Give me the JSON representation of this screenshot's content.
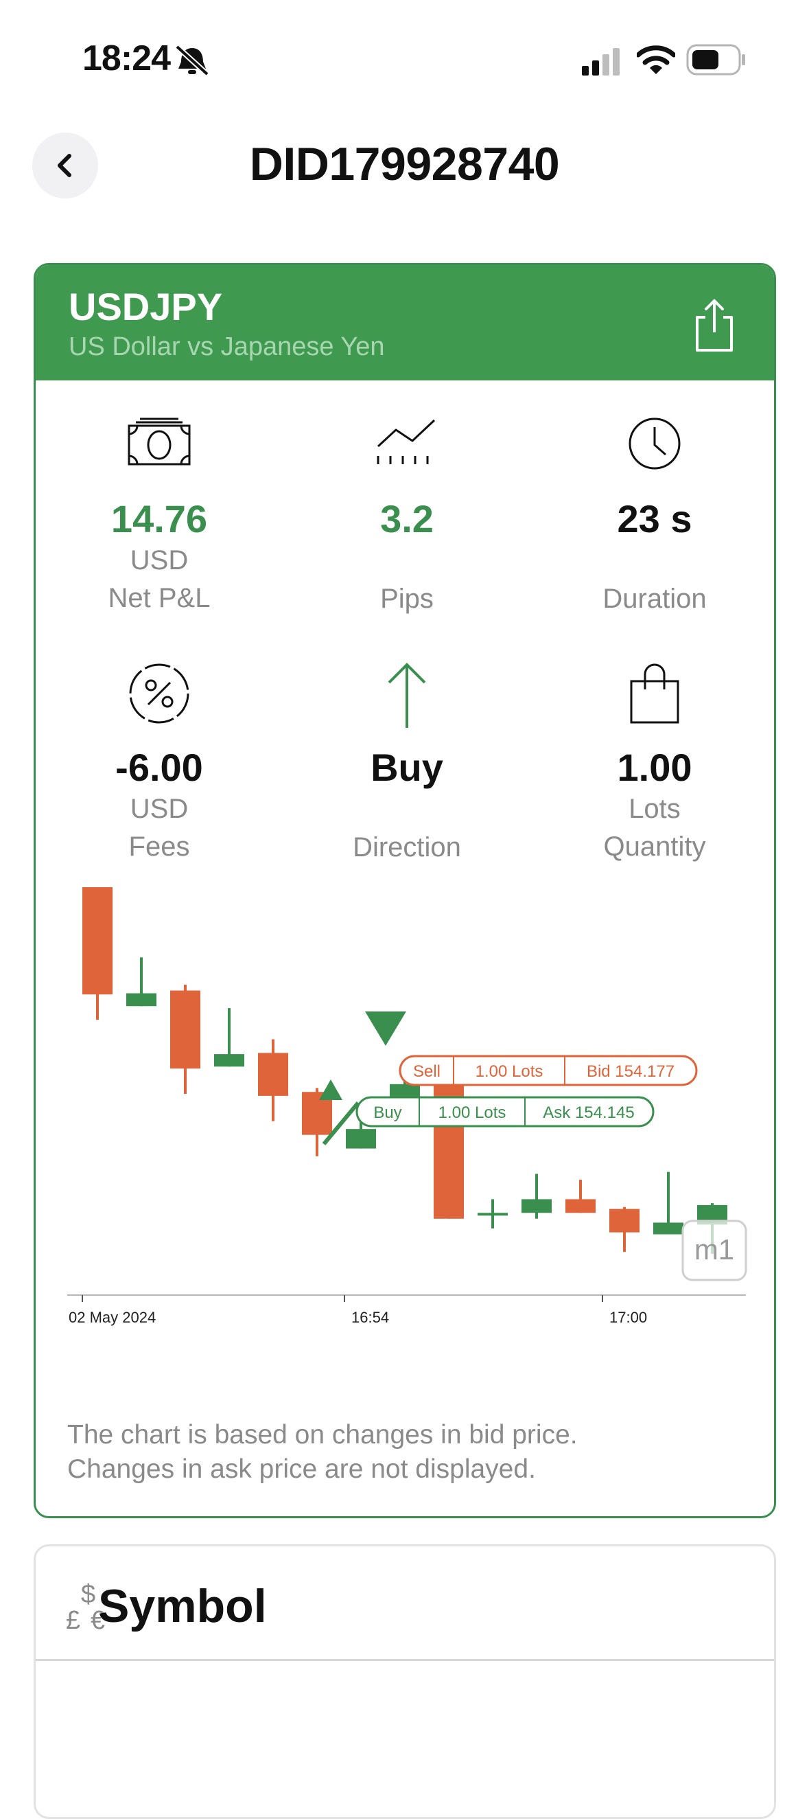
{
  "status_bar": {
    "time": "18:24"
  },
  "nav": {
    "title": "DID179928740"
  },
  "header": {
    "symbol": "USDJPY",
    "description": "US Dollar vs Japanese Yen"
  },
  "stats": {
    "net_pl": {
      "value": "14.76",
      "unit": "USD",
      "label": "Net P&L"
    },
    "pips": {
      "value": "3.2",
      "label": "Pips"
    },
    "duration": {
      "value": "23 s",
      "label": "Duration"
    },
    "fees": {
      "value": "-6.00",
      "unit": "USD",
      "label": "Fees"
    },
    "direction": {
      "value": "Buy",
      "label": "Direction"
    },
    "quantity": {
      "value": "1.00",
      "unit": "Lots",
      "label": "Quantity"
    }
  },
  "chart": {
    "sell_tag": {
      "side": "Sell",
      "lots": "1.00 Lots",
      "price": "Bid 154.177"
    },
    "buy_tag": {
      "side": "Buy",
      "lots": "1.00 Lots",
      "price": "Ask 154.145"
    },
    "timeframe": "m1",
    "x_ticks": [
      "02 May 2024",
      "16:54",
      "17:00"
    ],
    "note_line1": "The chart is based on changes in bid price.",
    "note_line2": "Changes in ask price are not displayed.",
    "colors": {
      "up": "#3a8f4e",
      "down": "#e0643a"
    }
  },
  "chart_data": {
    "type": "candlestick",
    "x_ticks": [
      "02 May 2024",
      "16:54",
      "17:00"
    ],
    "candles": [
      {
        "direction": "down",
        "open": 1.0,
        "close": 0.725,
        "high": 1.0,
        "low": 0.66
      },
      {
        "direction": "up",
        "open": 0.695,
        "close": 0.728,
        "high": 0.82,
        "low": 0.695
      },
      {
        "direction": "down",
        "open": 0.735,
        "close": 0.535,
        "high": 0.75,
        "low": 0.47
      },
      {
        "direction": "up",
        "open": 0.54,
        "close": 0.572,
        "high": 0.69,
        "low": 0.54
      },
      {
        "direction": "down",
        "open": 0.575,
        "close": 0.465,
        "high": 0.61,
        "low": 0.4
      },
      {
        "direction": "down",
        "open": 0.475,
        "close": 0.365,
        "high": 0.485,
        "low": 0.31
      },
      {
        "direction": "up",
        "open": 0.33,
        "close": 0.38,
        "high": 0.4,
        "low": 0.33
      },
      {
        "direction": "up",
        "open": 0.43,
        "close": 0.495,
        "high": 0.55,
        "low": 0.43
      },
      {
        "direction": "down",
        "open": 0.495,
        "close": 0.15,
        "high": 0.5,
        "low": 0.15
      },
      {
        "direction": "up",
        "open": 0.16,
        "close": 0.165,
        "high": 0.2,
        "low": 0.125
      },
      {
        "direction": "up",
        "open": 0.165,
        "close": 0.2,
        "high": 0.265,
        "low": 0.15
      },
      {
        "direction": "down",
        "open": 0.2,
        "close": 0.165,
        "high": 0.25,
        "low": 0.165
      },
      {
        "direction": "down",
        "open": 0.175,
        "close": 0.115,
        "high": 0.18,
        "low": 0.065
      },
      {
        "direction": "up",
        "open": 0.11,
        "close": 0.14,
        "high": 0.27,
        "low": 0.11
      },
      {
        "direction": "up",
        "open": 0.135,
        "close": 0.185,
        "high": 0.19,
        "low": 0.06
      }
    ],
    "markers": [
      {
        "type": "buy-entry",
        "candle_index": 6
      },
      {
        "type": "sell-exit",
        "candle_index": 7
      }
    ]
  },
  "symbol_section": {
    "title": "Symbol"
  }
}
